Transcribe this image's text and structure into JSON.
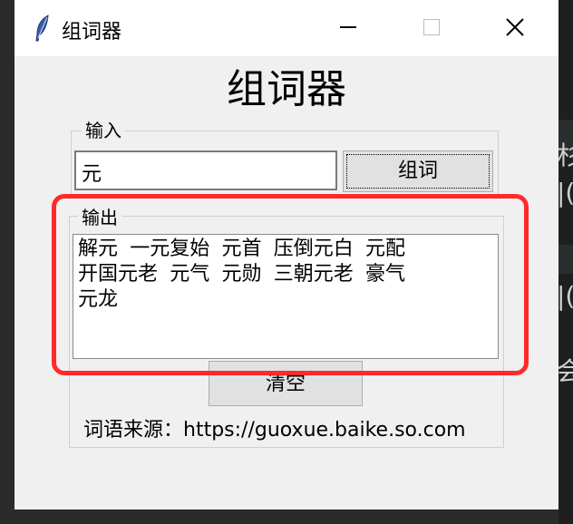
{
  "window": {
    "title": "组词器",
    "minimize_label": "",
    "maximize_label": "",
    "close_label": "✕"
  },
  "main": {
    "heading": "组词器",
    "input_group_label": "输入",
    "input_value": "元",
    "compose_button": "组词",
    "output_group_label": "输出",
    "output_text": "解元 一元复始 元首 压倒元白 元配\n开国元老 元气 元勋 三朝元老 豪气\n元龙",
    "clear_button": "清空",
    "source_text": "词语来源：https://guoxue.baike.so.com"
  },
  "background": {
    "fragments": [
      "I",
      "杉",
      "|(",
      "|(",
      "会"
    ]
  },
  "colors": {
    "highlight": "#ff2a2a",
    "window_bg": "#f0f0f0"
  }
}
